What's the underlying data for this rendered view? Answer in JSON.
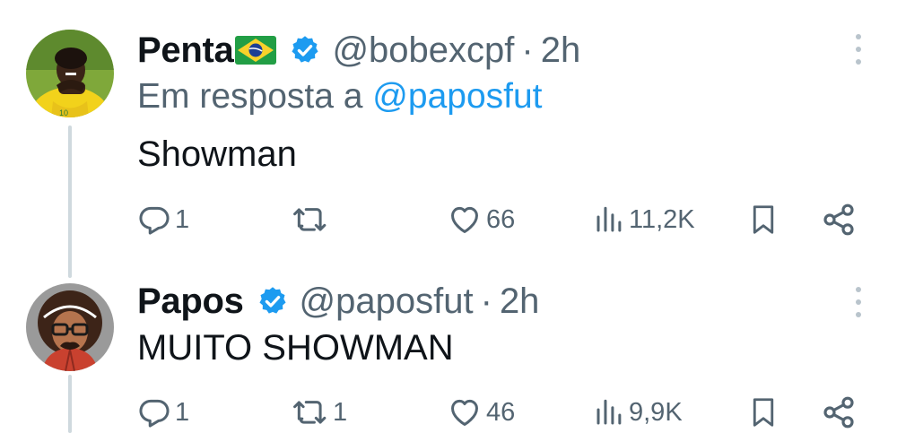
{
  "tweets": [
    {
      "author_name": "Penta",
      "author_flag": "brazil-flag",
      "verified": true,
      "handle": "@bobexcpf",
      "separator": "·",
      "time": "2h",
      "reply_prefix": "Em resposta a",
      "reply_mention": "@paposfut",
      "text": "Showman",
      "stats": {
        "replies": "1",
        "retweets": "",
        "likes": "66",
        "views": "11,2K"
      }
    },
    {
      "author_name": "Papos",
      "verified": true,
      "handle": "@paposfut",
      "separator": "·",
      "time": "2h",
      "text": "MUITO SHOWMAN",
      "stats": {
        "replies": "1",
        "retweets": "1",
        "likes": "46",
        "views": "9,9K"
      }
    }
  ],
  "colors": {
    "verified_badge": "#1d9bf0",
    "link": "#1d9bf0",
    "muted_text": "#536471",
    "thread_line": "#cfd9de"
  },
  "icons": [
    "reply-icon",
    "retweet-icon",
    "like-icon",
    "views-icon",
    "bookmark-icon",
    "share-icon",
    "more-icon",
    "verified-icon"
  ]
}
